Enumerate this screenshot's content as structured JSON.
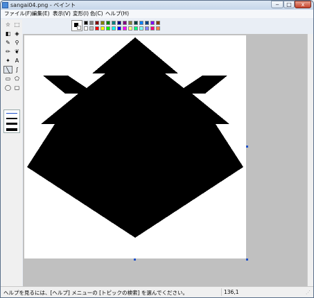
{
  "window": {
    "title": "sangai04.png - ペイント"
  },
  "window_buttons": {
    "minimize": "‒",
    "maximize": "□",
    "close": "x"
  },
  "menu": [
    {
      "label": "ファイル(F)"
    },
    {
      "label": "編集(E)"
    },
    {
      "label": "表示(V)"
    },
    {
      "label": "変形(I)"
    },
    {
      "label": "色(C)"
    },
    {
      "label": "ヘルプ(H)"
    }
  ],
  "tools": [
    {
      "name": "free-select-icon",
      "glyph": "☆"
    },
    {
      "name": "rect-select-icon",
      "glyph": "⬚"
    },
    {
      "name": "eraser-icon",
      "glyph": "◧"
    },
    {
      "name": "fill-icon",
      "glyph": "◈"
    },
    {
      "name": "color-picker-icon",
      "glyph": "✎"
    },
    {
      "name": "magnifier-icon",
      "glyph": "⚲"
    },
    {
      "name": "pencil-icon",
      "glyph": "✏"
    },
    {
      "name": "brush-icon",
      "glyph": "❦"
    },
    {
      "name": "airbrush-icon",
      "glyph": "✦"
    },
    {
      "name": "text-icon",
      "glyph": "A"
    },
    {
      "name": "line-icon",
      "glyph": "╲",
      "selected": true
    },
    {
      "name": "curve-icon",
      "glyph": "∫"
    },
    {
      "name": "rectangle-icon",
      "glyph": "▭"
    },
    {
      "name": "polygon-icon",
      "glyph": "⬠"
    },
    {
      "name": "ellipse-icon",
      "glyph": "◯"
    },
    {
      "name": "rounded-rect-icon",
      "glyph": "▢"
    }
  ],
  "palette": {
    "foreground": "#000000",
    "background": "#ffffff",
    "top_row": [
      "#000000",
      "#808080",
      "#800000",
      "#808000",
      "#008000",
      "#008080",
      "#000080",
      "#800080",
      "#808040",
      "#004040",
      "#0080ff",
      "#004080",
      "#8000ff",
      "#804000"
    ],
    "bottom_row": [
      "#ffffff",
      "#c0c0c0",
      "#ff0000",
      "#ffff00",
      "#00ff00",
      "#00ffff",
      "#0000ff",
      "#ff00ff",
      "#ffff80",
      "#00ff80",
      "#80ffff",
      "#8080ff",
      "#ff0080",
      "#ff8040"
    ]
  },
  "status": {
    "help_text": "ヘルプを見るには、[ヘルプ] メニューの [トピックの検索] を選んでください。",
    "coords": "136,1"
  }
}
